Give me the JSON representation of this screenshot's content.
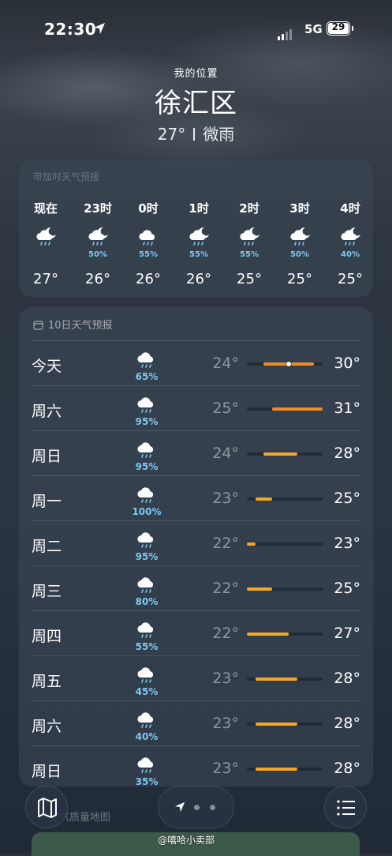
{
  "status_bar": {
    "time": "22:30",
    "network": "5G",
    "battery_level": "29",
    "icons": [
      "location-arrow-icon",
      "signal-icon",
      "battery-icon"
    ]
  },
  "header": {
    "my_location": "我的位置",
    "city": "徐汇区",
    "current_temp": "27°",
    "condition": "微雨"
  },
  "hourly": {
    "hint": "带加时天气预报",
    "items": [
      {
        "label": "现在",
        "temp": "27°",
        "pct": "",
        "icon": "moon-cloud-rain-icon"
      },
      {
        "label": "23时",
        "temp": "26°",
        "pct": "50%",
        "icon": "moon-cloud-rain-icon"
      },
      {
        "label": "0时",
        "temp": "26°",
        "pct": "55%",
        "icon": "cloud-rain-icon"
      },
      {
        "label": "1时",
        "temp": "26°",
        "pct": "55%",
        "icon": "moon-cloud-rain-icon"
      },
      {
        "label": "2时",
        "temp": "25°",
        "pct": "55%",
        "icon": "moon-cloud-rain-icon"
      },
      {
        "label": "3时",
        "temp": "25°",
        "pct": "50%",
        "icon": "moon-cloud-rain-icon"
      },
      {
        "label": "4时",
        "temp": "25°",
        "pct": "40%",
        "icon": "moon-cloud-rain-icon"
      }
    ]
  },
  "daily": {
    "title": "10日天气预报",
    "range_min": 22,
    "range_max": 31,
    "current_temp": 27,
    "days": [
      {
        "name": "今天",
        "pct": "65%",
        "low": "24°",
        "high": "30°",
        "lo": 24,
        "hi": 30
      },
      {
        "name": "周六",
        "pct": "95%",
        "low": "25°",
        "high": "31°",
        "lo": 25,
        "hi": 31
      },
      {
        "name": "周日",
        "pct": "95%",
        "low": "24°",
        "high": "28°",
        "lo": 24,
        "hi": 28
      },
      {
        "name": "周一",
        "pct": "100%",
        "low": "23°",
        "high": "25°",
        "lo": 23,
        "hi": 25
      },
      {
        "name": "周二",
        "pct": "95%",
        "low": "22°",
        "high": "23°",
        "lo": 22,
        "hi": 23
      },
      {
        "name": "周三",
        "pct": "80%",
        "low": "22°",
        "high": "25°",
        "lo": 22,
        "hi": 25
      },
      {
        "name": "周四",
        "pct": "55%",
        "low": "22°",
        "high": "27°",
        "lo": 22,
        "hi": 27
      },
      {
        "name": "周五",
        "pct": "45%",
        "low": "23°",
        "high": "28°",
        "lo": 23,
        "hi": 28
      },
      {
        "name": "周六",
        "pct": "40%",
        "low": "23°",
        "high": "28°",
        "lo": 23,
        "hi": 28
      },
      {
        "name": "周日",
        "pct": "35%",
        "low": "23°",
        "high": "28°",
        "lo": 23,
        "hi": 28
      }
    ]
  },
  "bottom": {
    "air_quality_label": "空气质量地图",
    "watermark": "@嘻哈小卖部"
  },
  "colors": {
    "bar_warm": "#f5a623",
    "bar_hot": "#f08a24",
    "pct_blue": "#7fc8f0"
  }
}
